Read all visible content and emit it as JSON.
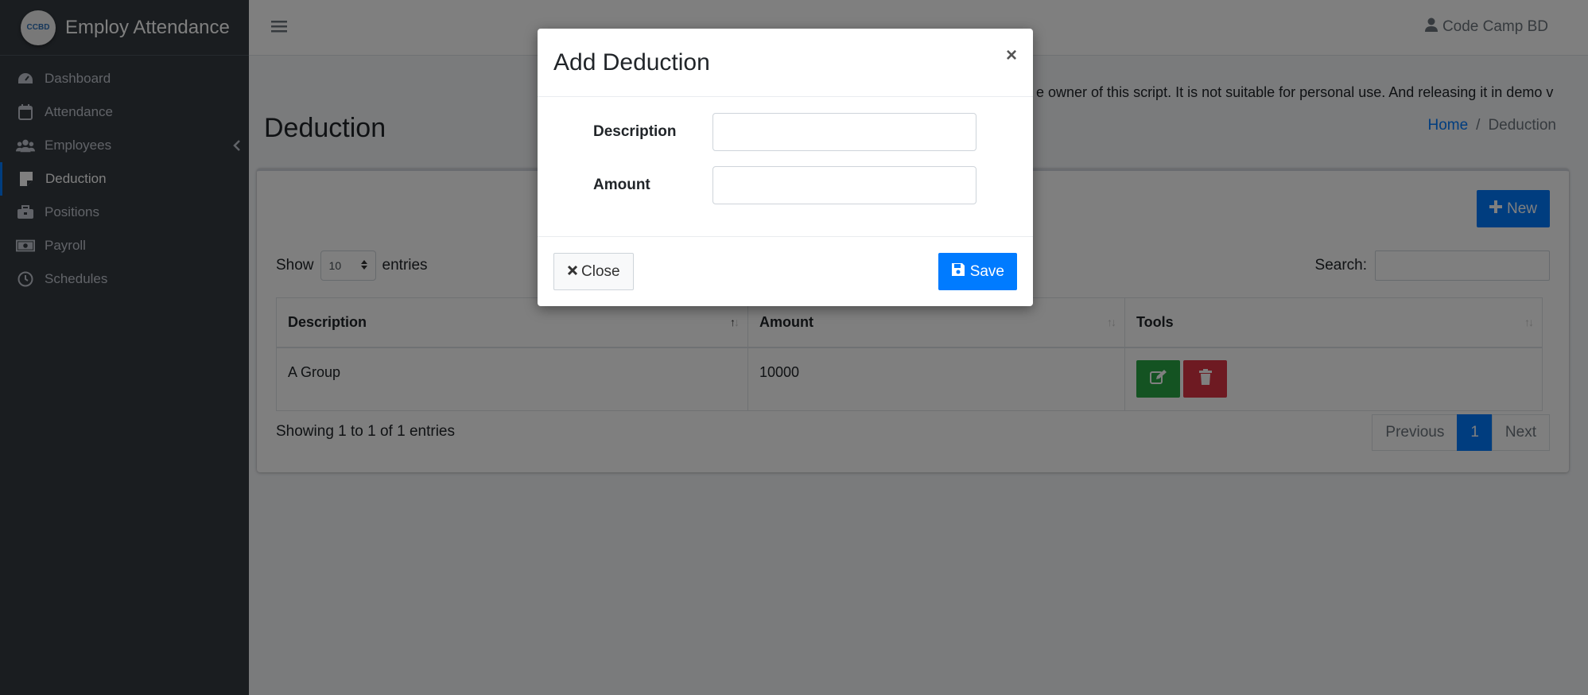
{
  "app": {
    "title": "Employ Attendance",
    "logo_text": "CCBD"
  },
  "sidebar": {
    "items": [
      {
        "label": "Dashboard",
        "icon": "dashboard-icon"
      },
      {
        "label": "Attendance",
        "icon": "calendar-icon"
      },
      {
        "label": "Employees",
        "icon": "users-icon"
      },
      {
        "label": "Deduction",
        "icon": "file-icon"
      },
      {
        "label": "Positions",
        "icon": "briefcase-icon"
      },
      {
        "label": "Payroll",
        "icon": "money-icon"
      },
      {
        "label": "Schedules",
        "icon": "clock-icon"
      }
    ],
    "active": "Deduction"
  },
  "header": {
    "user_name": "Code Camp BD"
  },
  "notice": "e owner of this script. It is not suitable for personal use. And releasing it in demo v",
  "page": {
    "title": "Deduction",
    "breadcrumb": {
      "home": "Home",
      "separator": "/",
      "current": "Deduction"
    }
  },
  "toolbar": {
    "new_label": "New"
  },
  "table_controls": {
    "show_label": "Show",
    "page_size": "10",
    "entries_label": "entries",
    "search_label": "Search:"
  },
  "table": {
    "columns": [
      "Description",
      "Amount",
      "Tools"
    ],
    "rows": [
      {
        "description": "A Group",
        "amount": "10000"
      }
    ]
  },
  "footer": {
    "info": "Showing 1 to 1 of 1 entries",
    "pagination": {
      "previous": "Previous",
      "current": "1",
      "next": "Next"
    }
  },
  "modal": {
    "title": "Add Deduction",
    "close_symbol": "×",
    "fields": [
      {
        "label": "Description",
        "value": ""
      },
      {
        "label": "Amount",
        "value": ""
      }
    ],
    "close_label": "Close",
    "save_label": "Save"
  },
  "colors": {
    "primary": "#007bff",
    "success": "#28a745",
    "danger": "#dc3545",
    "sidebar": "#343a40"
  }
}
